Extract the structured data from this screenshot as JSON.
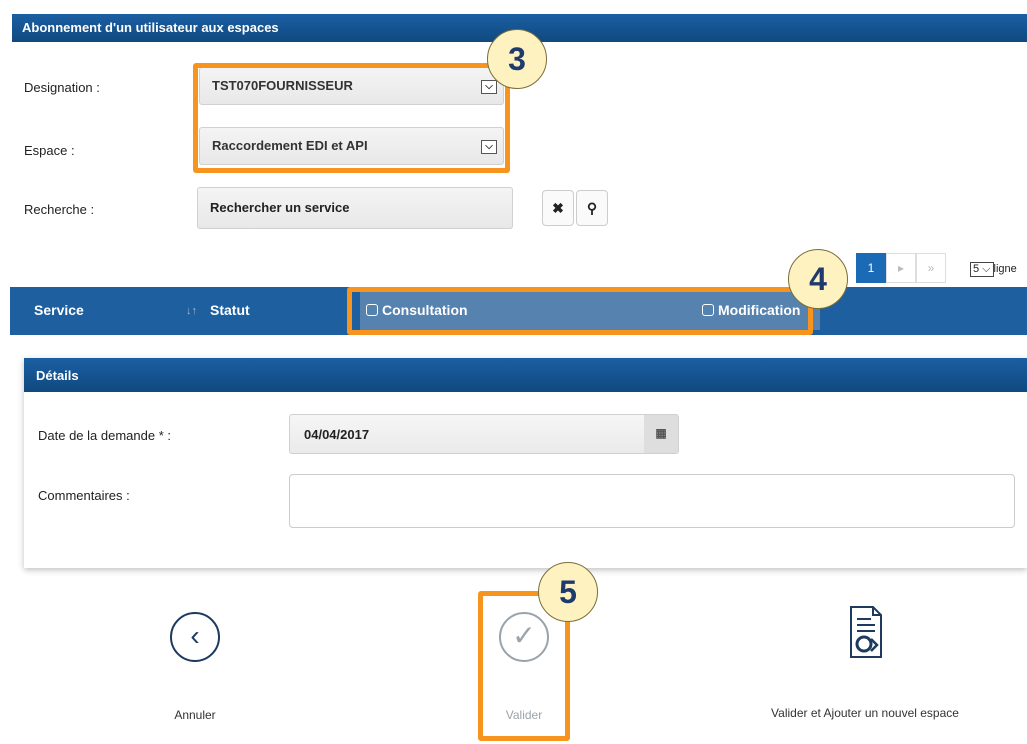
{
  "header": {
    "title": "Abonnement d'un utilisateur aux espaces"
  },
  "form": {
    "designation_label": "Designation :",
    "designation_value": "TST070FOURNISSEUR",
    "espace_label": "Espace :",
    "espace_value": "Raccordement EDI et API",
    "recherche_label": "Recherche :",
    "recherche_placeholder": "Rechercher un service"
  },
  "pager": {
    "current_page": "1",
    "rows_value": "5",
    "rows_label": "ligne"
  },
  "table": {
    "col_service": "Service",
    "col_sort": "↓↑",
    "col_statut": "Statut",
    "col_consultation": "Consultation",
    "col_modification": "Modification"
  },
  "details": {
    "title": "Détails",
    "date_label": "Date de la demande * :",
    "date_value": "04/04/2017",
    "comment_label": "Commentaires :"
  },
  "actions": {
    "cancel": "Annuler",
    "validate": "Valider",
    "validate_add": "Valider et Ajouter un nouvel espace"
  },
  "annotations": {
    "step3": "3",
    "step4": "4",
    "step5": "5"
  },
  "colors": {
    "accent": "#1b5fa3",
    "highlight": "#f7941d",
    "badge": "#fdf2c0"
  }
}
